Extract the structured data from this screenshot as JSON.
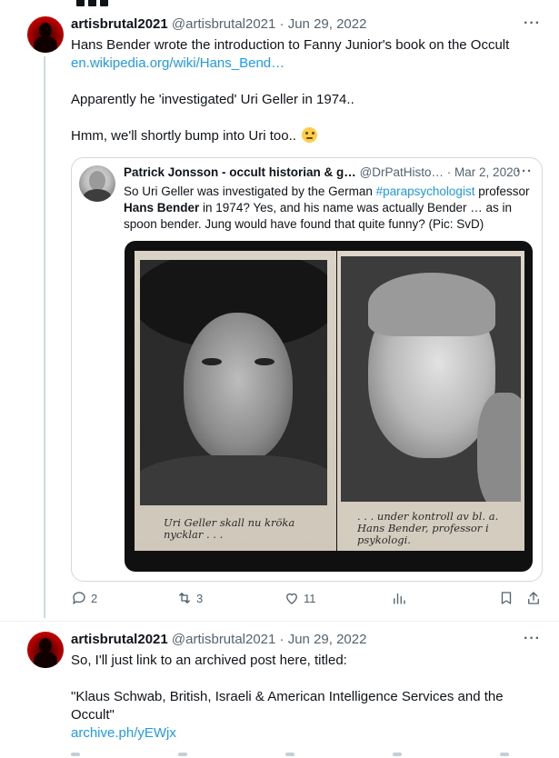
{
  "colors": {
    "link": "#1d9bf0",
    "meta": "#536471",
    "text": "#0f1419",
    "border": "#cfd9de"
  },
  "tweet1": {
    "display_name": "artisbrutal2021",
    "handle": "@artisbrutal2021",
    "date": "Jun 29, 2022",
    "line1": "Hans Bender wrote the introduction to Fanny Junior's book on the Occult",
    "link": "en.wikipedia.org/wiki/Hans_Bend…",
    "line2": "Apparently he 'investigated' Uri Geller in 1974..",
    "line3": "Hmm, we'll shortly bump into Uri too..",
    "emoji": "thinking-face"
  },
  "quote": {
    "display_name": "Patrick Jonsson - occult historian & g…",
    "handle": "@DrPatHisto…",
    "date": "Mar 2, 2020",
    "line1_a": "So Uri Geller was investigated by the German ",
    "hashtag": "#parapsychologist",
    "line1_b": " professor",
    "line2_bold": "Hans Bender",
    "line2_rest": " in 1974? Yes, and his name was actually Bender … as in",
    "line3": "spoon bender. Jung would have found that quite funny? (Pic: SvD)",
    "caption_left_1": "Uri Geller skall nu kröka",
    "caption_left_2": "nycklar . . .",
    "caption_right_1": ". . . under kontroll av bl. a.",
    "caption_right_2": "Hans Bender, professor i",
    "caption_right_3": "psykologi."
  },
  "actions": {
    "reply_count": "2",
    "retweet_count": "3",
    "like_count": "11"
  },
  "tweet2": {
    "display_name": "artisbrutal2021",
    "handle": "@artisbrutal2021",
    "date": "Jun 29, 2022",
    "line1": "So, I'll just link to an archived post here, titled:",
    "line2": "\"Klaus Schwab, British, Israeli & American Intelligence Services and the",
    "line3": "Occult\"",
    "link": "archive.ph/yEWjx"
  },
  "more_label": "···",
  "dot_sep": " · "
}
